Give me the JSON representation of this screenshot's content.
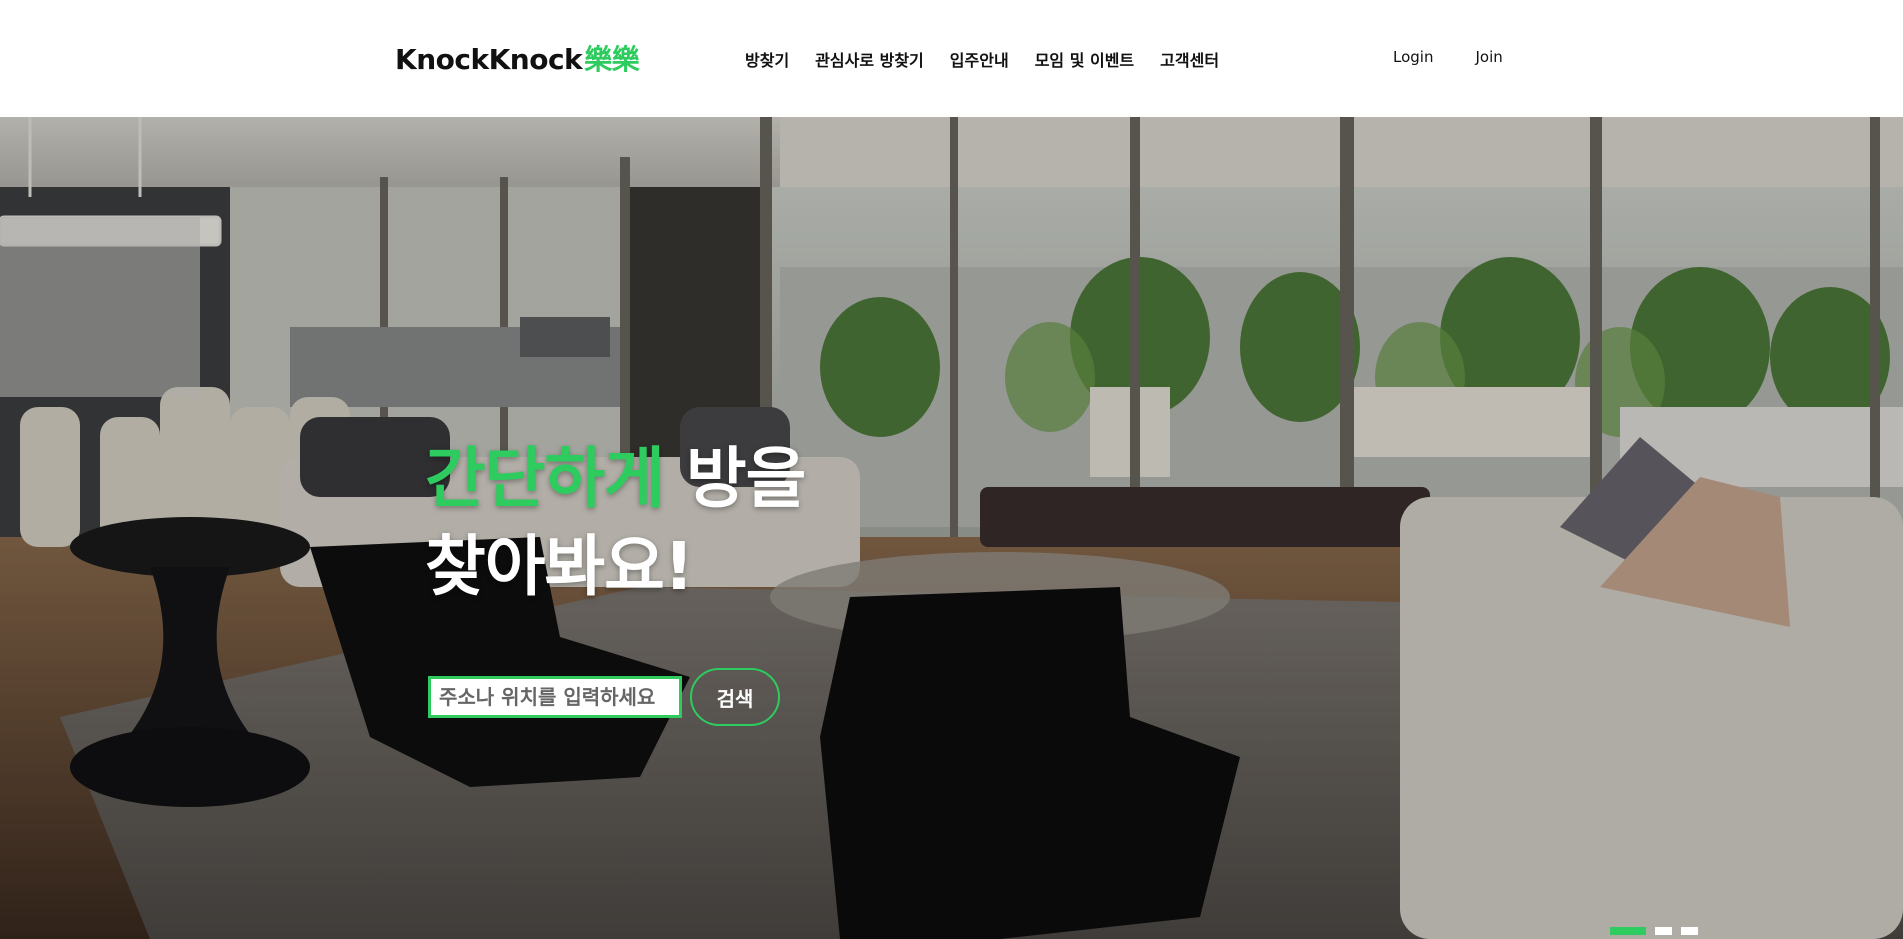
{
  "header": {
    "logo": {
      "text": "KnockKnock",
      "accent": "樂樂"
    },
    "nav": [
      {
        "label": "방찾기"
      },
      {
        "label": "관심사로 방찾기"
      },
      {
        "label": "입주안내"
      },
      {
        "label": "모임 및 이벤트"
      },
      {
        "label": "고객센터"
      }
    ],
    "auth": {
      "login": "Login",
      "join": "Join"
    }
  },
  "hero": {
    "headline_green": "간단하게",
    "headline_white1": "방을",
    "headline_line2": "찾아봐요!",
    "search": {
      "placeholder": "주소나 위치를 입력하세요",
      "value": "",
      "button": "검색"
    },
    "slider": {
      "count": 3,
      "active_index": 0
    }
  },
  "colors": {
    "accent": "#2ecc5f",
    "header_bg": "#ffffff",
    "text": "#111111"
  }
}
